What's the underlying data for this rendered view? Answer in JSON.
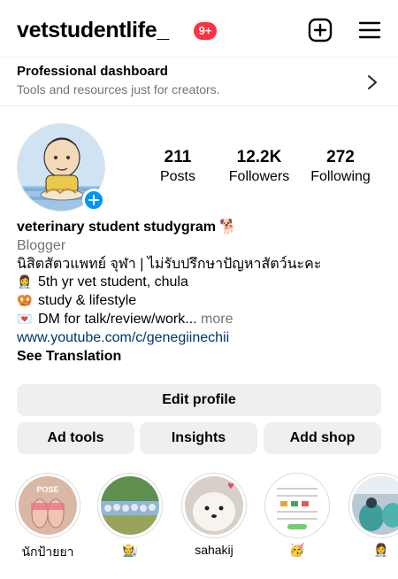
{
  "header": {
    "username": "vetstudentlife_",
    "notification_badge": "9+",
    "create_icon": "plus-square-icon",
    "menu_icon": "hamburger-menu-icon"
  },
  "dashboard": {
    "title": "Professional dashboard",
    "subtitle": "Tools and resources just for creators.",
    "chevron_icon": "chevron-right-icon"
  },
  "profile": {
    "avatar_icon": "cartoon-avatar",
    "add_story_icon": "plus-circle-icon",
    "stats": {
      "posts": {
        "value": "211",
        "label": "Posts"
      },
      "followers": {
        "value": "12.2K",
        "label": "Followers"
      },
      "following": {
        "value": "272",
        "label": "Following"
      }
    }
  },
  "bio": {
    "name": "veterinary student studygram",
    "name_emoji": "🐕",
    "category": "Blogger",
    "lines": [
      {
        "emoji": "",
        "text": "นิสิตสัตวแพทย์ จุฬา | ไม่รับปรึกษาปัญหาสัตว์นะคะ"
      },
      {
        "emoji": "👩‍⚕️",
        "text": "5th yr vet student, chula"
      },
      {
        "emoji": "🥨",
        "text": "study & lifestyle"
      },
      {
        "emoji": "💌",
        "text": "DM for talk/review/work..."
      }
    ],
    "more": "more",
    "link": "www.youtube.com/c/genegiinechii",
    "see_translation": "See Translation"
  },
  "buttons": {
    "edit_profile": "Edit profile",
    "ad_tools": "Ad tools",
    "insights": "Insights",
    "add_shop": "Add shop"
  },
  "highlights": [
    {
      "label": "นักป้ายยา",
      "thumb": "feet-pose-thumbnail"
    },
    {
      "label": "🧑‍🌾",
      "thumb": "group-photo-thumbnail"
    },
    {
      "label": "sahakij",
      "thumb": "white-dog-thumbnail"
    },
    {
      "label": "🥳",
      "thumb": "document-thumbnail"
    },
    {
      "label": "👩‍⚕️",
      "thumb": "hospital-thumbnail"
    }
  ],
  "colors": {
    "accent_blue": "#0095f6",
    "badge_red": "#ff3040",
    "link_blue": "#00376b",
    "muted_gray": "#737373",
    "button_gray": "#efefef"
  }
}
